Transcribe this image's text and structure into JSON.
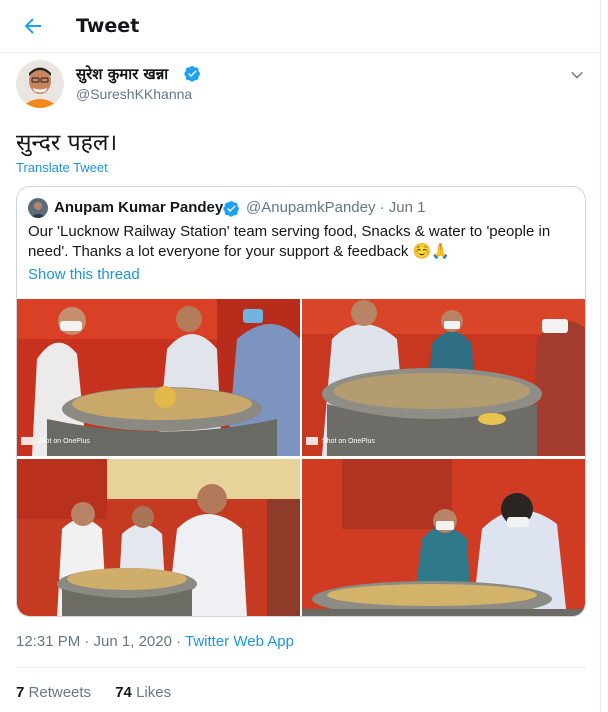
{
  "header": {
    "title": "Tweet"
  },
  "author": {
    "name": "सुरेश कुमार खन्ना",
    "handle": "@SureshKKhanna"
  },
  "tweet": {
    "text": "सुन्दर पहल।",
    "translate_label": "Translate Tweet"
  },
  "quote": {
    "name": "Anupam Kumar Pandey",
    "handle_date": "@AnupamkPandey · Jun 1",
    "text": "Our 'Lucknow Railway Station' team serving food, Snacks & water to 'people in need'. Thanks a lot everyone for your support & feedback ☺️🙏",
    "thread_link": "Show this thread",
    "watermark": "Shot on OnePlus"
  },
  "meta": {
    "time_date": "12:31 PM · Jun 1, 2020 · ",
    "app": "Twitter Web App"
  },
  "stats": {
    "retweets_count": "7",
    "retweets_label": "Retweets",
    "likes_count": "74",
    "likes_label": "Likes"
  },
  "colors": {
    "accent": "#1b95e0",
    "verified": "#1da1f2",
    "muted": "#657786",
    "border": "#e6ecf0"
  },
  "icons": [
    "back-arrow-icon",
    "verified-badge-icon",
    "chevron-down-icon"
  ]
}
